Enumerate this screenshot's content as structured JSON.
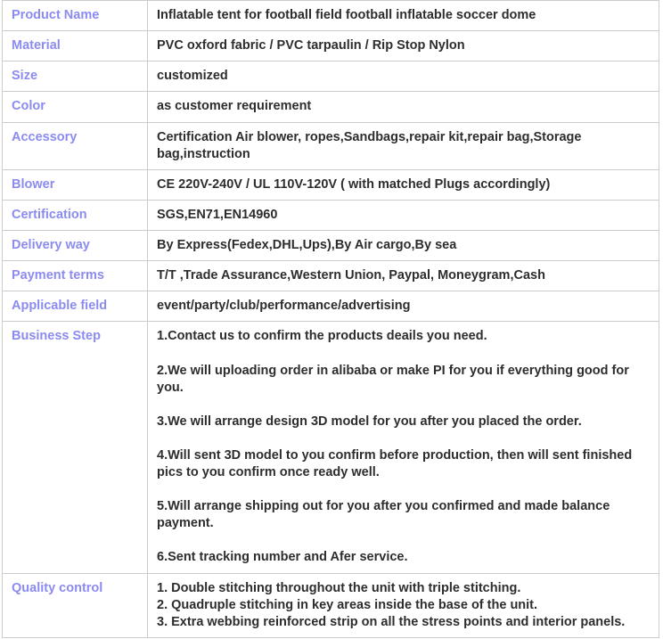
{
  "colors": {
    "label_text": "#8b8bf0",
    "value_text": "#2d2d2d",
    "border": "#cccccc",
    "background": "#ffffff"
  },
  "table": {
    "rows": [
      {
        "label": "Product Name",
        "value": "Inflatable tent for football field football inflatable soccer dome"
      },
      {
        "label": "Material",
        "value": "PVC oxford fabric / PVC tarpaulin / Rip Stop Nylon"
      },
      {
        "label": "Size",
        "value": "customized"
      },
      {
        "label": "Color",
        "value": "as customer requirement"
      },
      {
        "label": "Accessory",
        "value": "Certification Air blower, ropes,Sandbags,repair kit,repair bag,Storage bag,instruction"
      },
      {
        "label": "Blower",
        "value": "CE 220V-240V / UL 110V-120V ( with matched Plugs accordingly)"
      },
      {
        "label": "Certification",
        "value": "SGS,EN71,EN14960"
      },
      {
        "label": "Delivery way",
        "value": "By Express(Fedex,DHL,Ups),By Air cargo,By sea"
      },
      {
        "label": "Payment terms",
        "value": "T/T ,Trade Assurance,Western Union, Paypal, Moneygram,Cash"
      },
      {
        "label": "Applicable field",
        "value": "event/party/club/performance/advertising"
      }
    ],
    "business_step": {
      "label": "Business Step",
      "paragraphs": [
        "1.Contact us to confirm the products deails you need.",
        "2.We will uploading order in alibaba or make PI for you if everything good for you.",
        "3.We will arrange design 3D model for you after you placed the order.",
        "4.Will sent 3D model to you confirm before production, then will sent finished pics to you confirm once ready well.",
        "5.Will arrange shipping out for you after you confirmed and made balance payment.",
        "6.Sent tracking number and Afer service."
      ]
    },
    "quality_control": {
      "label": "Quality control",
      "lines": [
        "1. Double stitching throughout the unit with triple stitching.",
        "2. Quadruple stitching in key areas inside the base of the unit.",
        "3. Extra webbing reinforced strip on all the stress points and interior panels."
      ]
    }
  }
}
